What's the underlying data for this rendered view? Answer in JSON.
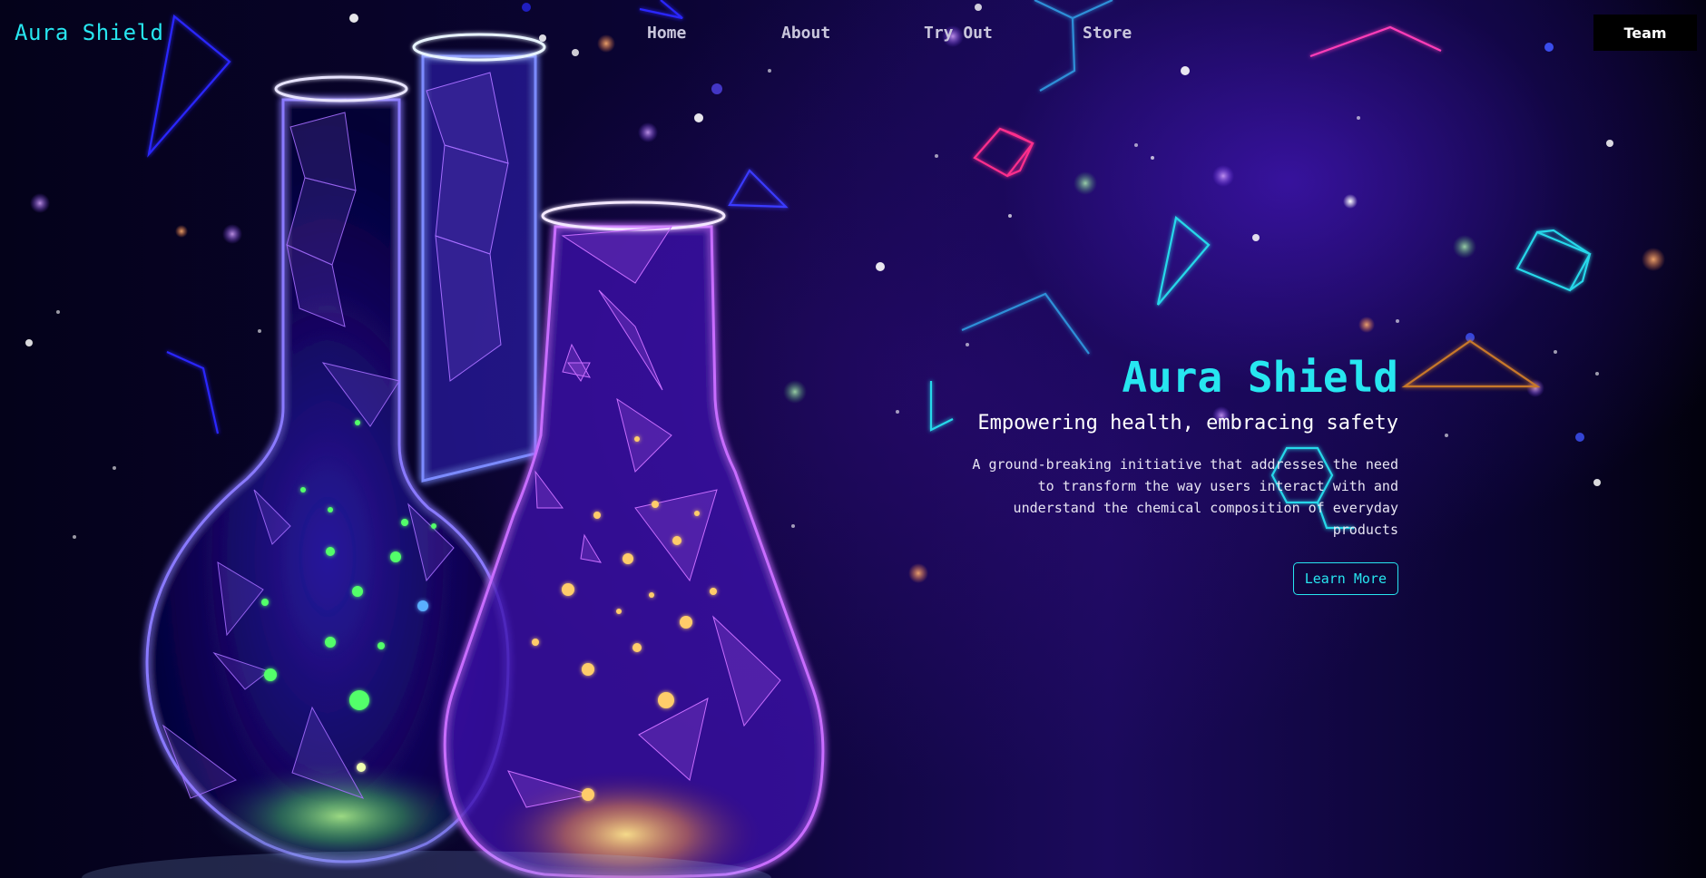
{
  "brand": {
    "logo_text": "Aura Shield"
  },
  "nav": {
    "links": [
      {
        "label": "Home"
      },
      {
        "label": "About"
      },
      {
        "label": "Try Out"
      },
      {
        "label": "Store"
      }
    ],
    "team_button": "Team"
  },
  "hero": {
    "title": "Aura Shield",
    "subtitle": "Empowering health, embracing safety",
    "description": "A ground-breaking initiative that addresses the need to transform the way users interact with and understand the chemical composition of everyday products",
    "cta_label": "Learn More"
  },
  "colors": {
    "accent": "#27e6f0",
    "background": "#05031a",
    "flask_glow": "#6a4dff",
    "pink_glow": "#ff3db8",
    "green_liquid": "#4dff7a",
    "gold_liquid": "#ffc84d"
  },
  "illustration": {
    "icons": [
      "flask-icon",
      "beaker-icon",
      "cube-icon",
      "triangle-icon",
      "hexagon-icon"
    ]
  }
}
